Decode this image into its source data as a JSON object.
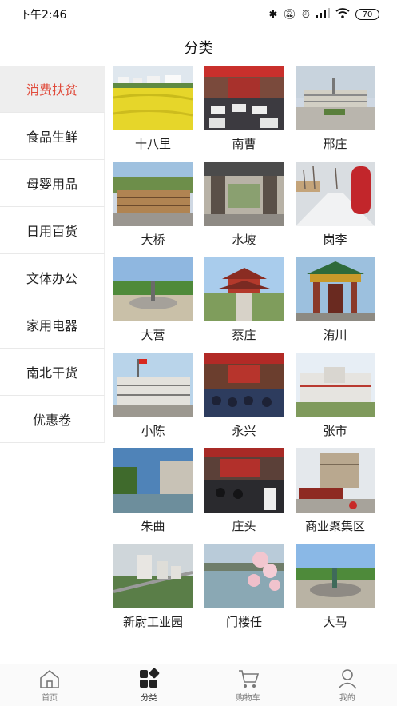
{
  "status_bar": {
    "time": "下午2:46",
    "battery": "70"
  },
  "header": {
    "title": "分类"
  },
  "sidebar": {
    "items": [
      {
        "label": "消费扶贫",
        "active": true
      },
      {
        "label": "食品生鲜"
      },
      {
        "label": "母婴用品"
      },
      {
        "label": "日用百货"
      },
      {
        "label": "文体办公"
      },
      {
        "label": "家用电器"
      },
      {
        "label": "南北干货"
      },
      {
        "label": "优惠卷"
      }
    ]
  },
  "grid": {
    "items": [
      {
        "label": "十八里"
      },
      {
        "label": "南曹"
      },
      {
        "label": "邢庄"
      },
      {
        "label": "大桥"
      },
      {
        "label": "水坡"
      },
      {
        "label": "岗李"
      },
      {
        "label": "大营"
      },
      {
        "label": "蔡庄"
      },
      {
        "label": "洧川"
      },
      {
        "label": "小陈"
      },
      {
        "label": "永兴"
      },
      {
        "label": "张市"
      },
      {
        "label": "朱曲"
      },
      {
        "label": "庄头"
      },
      {
        "label": "商业聚集区"
      },
      {
        "label": "新尉工业园"
      },
      {
        "label": "门楼任"
      },
      {
        "label": "大马"
      }
    ]
  },
  "bottom_nav": {
    "items": [
      {
        "label": "首页",
        "icon": "home-icon"
      },
      {
        "label": "分类",
        "icon": "category-icon",
        "active": true
      },
      {
        "label": "购物车",
        "icon": "cart-icon"
      },
      {
        "label": "我的",
        "icon": "user-icon"
      }
    ]
  },
  "colors": {
    "accent": "#e04a3a",
    "sidebar_active_bg": "#eeeeee"
  }
}
